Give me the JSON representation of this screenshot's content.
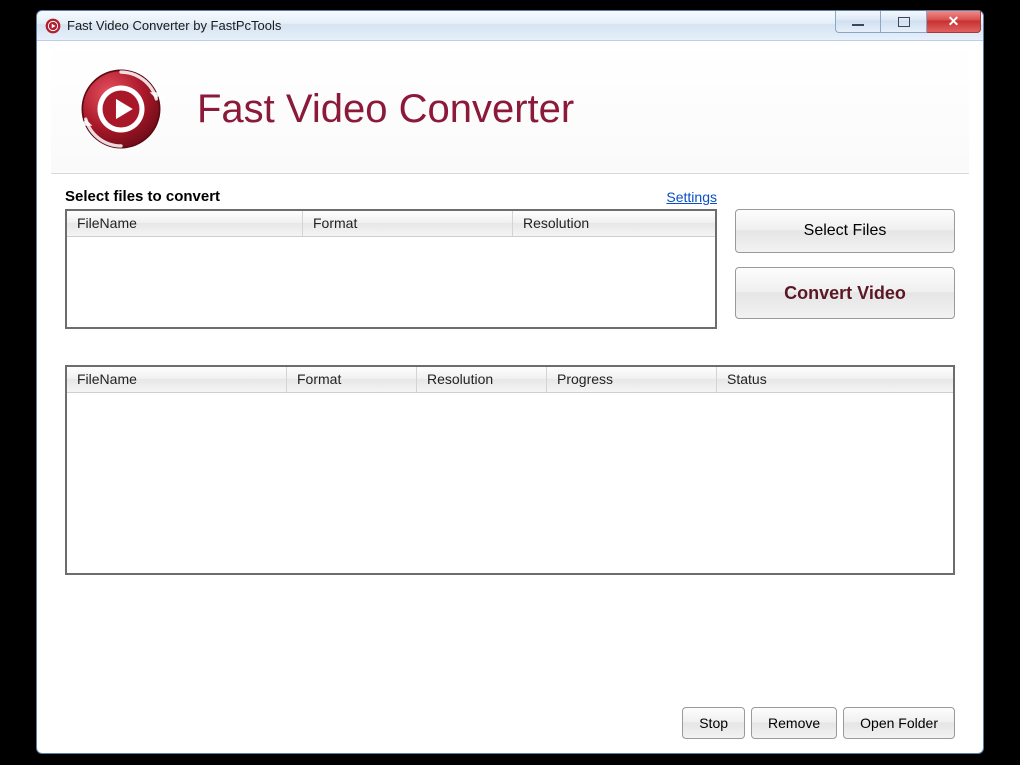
{
  "window": {
    "title": "Fast Video Converter by FastPcTools"
  },
  "header": {
    "title": "Fast Video Converter"
  },
  "top": {
    "section_label": "Select files to convert",
    "settings_link": "Settings",
    "columns": {
      "filename": "FileName",
      "format": "Format",
      "resolution": "Resolution"
    },
    "buttons": {
      "select_files": "Select Files",
      "convert": "Convert Video"
    }
  },
  "bottom": {
    "columns": {
      "filename": "FileName",
      "format": "Format",
      "resolution": "Resolution",
      "progress": "Progress",
      "status": "Status"
    }
  },
  "footer": {
    "stop": "Stop",
    "remove": "Remove",
    "open_folder": "Open Folder"
  }
}
